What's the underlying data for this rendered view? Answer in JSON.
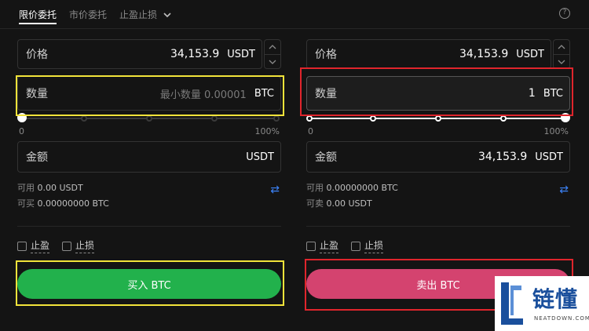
{
  "tabs": [
    {
      "label": "限价委托",
      "active": true
    },
    {
      "label": "市价委托",
      "active": false
    },
    {
      "label": "止盈止损",
      "active": false
    }
  ],
  "buy": {
    "price_label": "价格",
    "price_value": "34,153.9",
    "price_unit": "USDT",
    "qty_label": "数量",
    "qty_placeholder": "最小数量 0.00001",
    "qty_unit": "BTC",
    "slider_min": "0",
    "slider_max": "100%",
    "slider_level_percent": 0,
    "amount_label": "金额",
    "amount_value": "",
    "amount_unit": "USDT",
    "available_label": "可用",
    "available_value": "0.00 USDT",
    "can_label": "可买",
    "can_value": "0.00000000 BTC",
    "take_profit_label": "止盈",
    "stop_loss_label": "止损",
    "action_label": "买入 BTC"
  },
  "sell": {
    "price_label": "价格",
    "price_value": "34,153.9",
    "price_unit": "USDT",
    "qty_label": "数量",
    "qty_value": "1",
    "qty_unit": "BTC",
    "slider_min": "0",
    "slider_max": "100%",
    "slider_level_percent": 100,
    "amount_label": "金额",
    "amount_value": "34,153.9",
    "amount_unit": "USDT",
    "available_label": "可用",
    "available_value": "0.00000000 BTC",
    "can_label": "可卖",
    "can_value": "0.00 USDT",
    "take_profit_label": "止盈",
    "stop_loss_label": "止损",
    "action_label": "卖出 BTC"
  },
  "colors": {
    "buy": "#22b14c",
    "sell": "#d4436f",
    "highlight_yellow": "#f2e33a",
    "highlight_red": "#e0252c",
    "swap_icon": "#3b82f6"
  },
  "icons": {
    "help": "question-circle-icon",
    "swap": "swap-arrows-icon",
    "caret": "chevron-down-icon",
    "stepper_up": "chevron-up-icon",
    "stepper_down": "chevron-down-icon"
  },
  "watermark": {
    "cn": "链懂",
    "en": "NEATDOWN.COM"
  }
}
